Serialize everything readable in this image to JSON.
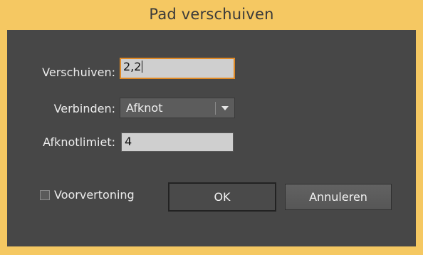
{
  "window": {
    "title": "Pad verschuiven"
  },
  "form": {
    "offset": {
      "label": "Verschuiven:",
      "value": "2,2"
    },
    "joins": {
      "label": "Verbinden:",
      "selected": "Afknot"
    },
    "miter_limit": {
      "label": "Afknotlimiet:",
      "value": "4"
    }
  },
  "footer": {
    "preview_label": "Voorvertoning",
    "preview_checked": false,
    "ok_label": "OK",
    "cancel_label": "Annuleren"
  },
  "colors": {
    "window_frame": "#f5c862",
    "panel": "#474747",
    "focus_ring": "#e08a26"
  }
}
